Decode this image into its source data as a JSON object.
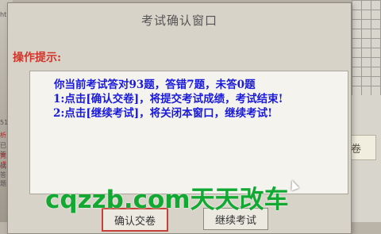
{
  "background": {
    "left_fragments": [
      "ht",
      "51",
      "析",
      "已答",
      "完成",
      "试答题"
    ],
    "submit_button_label": "交卷"
  },
  "dialog": {
    "title": "考试确认窗口",
    "hint_title": "操作提示:",
    "messages": [
      "你当前考试答对93题，答错7题，未答0题",
      "1:点击[确认交卷]，将提交考试成绩，考试结束!",
      "2:点击[继续考试]，将关闭本窗口，继续考试!"
    ],
    "confirm_button_label": "确认交卷",
    "continue_button_label": "继续考试"
  },
  "watermark": "cqzzb.com天天改车",
  "colors": {
    "hint_red": "#d3342a",
    "message_blue": "#1a1adb",
    "watermark_green": "#12a832"
  }
}
